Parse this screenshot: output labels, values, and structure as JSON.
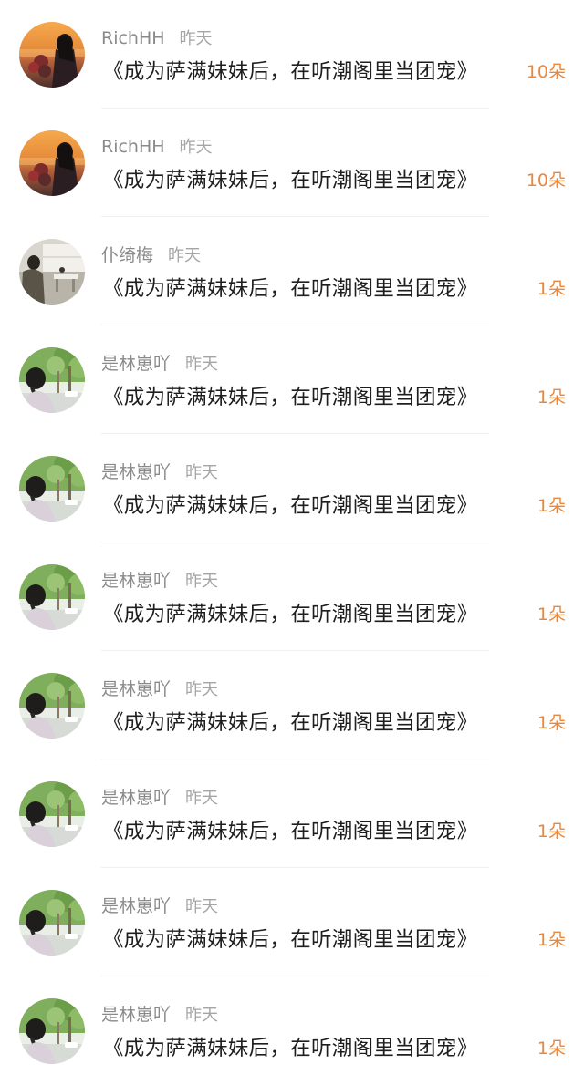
{
  "rows": [
    {
      "username": "RichHH",
      "time": "昨天",
      "book": "《成为萨满妹妹后，在听潮阁里当团宠》",
      "count": "10朵",
      "avatar": "sunset-woman-avatar"
    },
    {
      "username": "RichHH",
      "time": "昨天",
      "book": "《成为萨满妹妹后，在听潮阁里当团宠》",
      "count": "10朵",
      "avatar": "sunset-woman-avatar"
    },
    {
      "username": "仆绮梅",
      "time": "昨天",
      "book": "《成为萨满妹妹后，在听潮阁里当团宠》",
      "count": "1朵",
      "avatar": "window-person-avatar"
    },
    {
      "username": "是林崽吖",
      "time": "昨天",
      "book": "《成为萨满妹妹后，在听潮阁里当团宠》",
      "count": "1朵",
      "avatar": "trees-girl-avatar"
    },
    {
      "username": "是林崽吖",
      "time": "昨天",
      "book": "《成为萨满妹妹后，在听潮阁里当团宠》",
      "count": "1朵",
      "avatar": "trees-girl-avatar"
    },
    {
      "username": "是林崽吖",
      "time": "昨天",
      "book": "《成为萨满妹妹后，在听潮阁里当团宠》",
      "count": "1朵",
      "avatar": "trees-girl-avatar"
    },
    {
      "username": "是林崽吖",
      "time": "昨天",
      "book": "《成为萨满妹妹后，在听潮阁里当团宠》",
      "count": "1朵",
      "avatar": "trees-girl-avatar"
    },
    {
      "username": "是林崽吖",
      "time": "昨天",
      "book": "《成为萨满妹妹后，在听潮阁里当团宠》",
      "count": "1朵",
      "avatar": "trees-girl-avatar"
    },
    {
      "username": "是林崽吖",
      "time": "昨天",
      "book": "《成为萨满妹妹后，在听潮阁里当团宠》",
      "count": "1朵",
      "avatar": "trees-girl-avatar"
    },
    {
      "username": "是林崽吖",
      "time": "昨天",
      "book": "《成为萨满妹妹后，在听潮阁里当团宠》",
      "count": "1朵",
      "avatar": "trees-girl-avatar"
    }
  ],
  "colors": {
    "count": "#e8883e",
    "username": "#8a8a8a",
    "time": "#a5a5a5",
    "book": "#1e1e1e",
    "divider": "#efefef"
  }
}
